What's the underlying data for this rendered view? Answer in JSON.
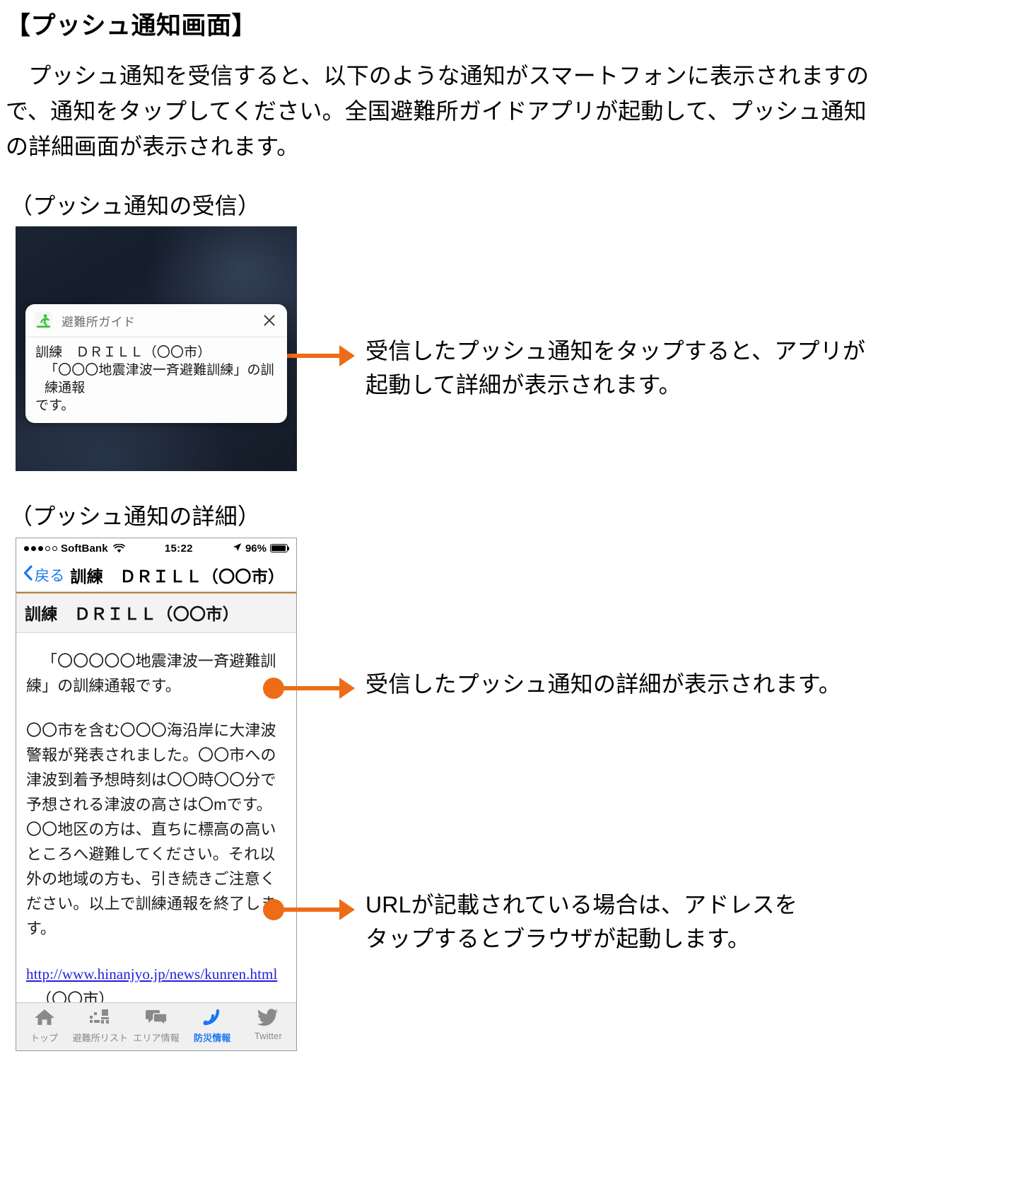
{
  "document": {
    "heading": "【プッシュ通知画面】",
    "intro_line1": "　プッシュ通知を受信すると、以下のような通知がスマートフォンに表示されますの",
    "intro_line2": "で、通知をタップしてください。全国避難所ガイドアプリが起動して、プッシュ通知",
    "intro_line3": "の詳細画面が表示されます。",
    "section_1_label": "（プッシュ通知の受信）",
    "section_2_label": "（プッシュ通知の詳細）"
  },
  "notification": {
    "app_icon_name": "running-person-icon",
    "app_name": "避難所ガイド",
    "close_icon_name": "close-icon",
    "body_line1": "訓練　ＤＲＩＬＬ（〇〇市）",
    "body_line2": "「〇〇〇地震津波一斉避難訓練」の訓練通報",
    "body_line3": "です。"
  },
  "detail_screen": {
    "status_bar": {
      "carrier": "SoftBank",
      "wifi_icon_name": "wifi-icon",
      "time": "15:22",
      "location_icon_name": "location-arrow-icon",
      "battery_percent": "96%",
      "signal_dots_filled": 3,
      "signal_dots_total": 5
    },
    "nav_bar": {
      "back_icon_name": "chevron-left-icon",
      "back_label": "戻る",
      "title": "訓練　ＤＲＩＬＬ（〇〇市）"
    },
    "title_bar": "訓練　ＤＲＩＬＬ（〇〇市）",
    "paragraph_1": "「〇〇〇〇〇地震津波一斉避難訓練」の訓練通報です。",
    "paragraph_2": "〇〇市を含む〇〇〇海沿岸に大津波警報が発表されました。〇〇市への津波到着予想時刻は〇〇時〇〇分で予想される津波の高さは〇mです。",
    "paragraph_3": "〇〇地区の方は、直ちに標高の高いところへ避難してください。それ以外の地域の方も、引き続きご注意ください。以上で訓練通報を終了します。",
    "url": "http://www.hinanjyo.jp/news/kunren.html",
    "footer_city": "（〇〇市）",
    "tabs": [
      {
        "label": "トップ",
        "icon": "home-icon",
        "active": false
      },
      {
        "label": "避難所リスト",
        "icon": "shelter-list-icon",
        "active": false
      },
      {
        "label": "エリア情報",
        "icon": "speech-bubbles-icon",
        "active": false
      },
      {
        "label": "防災情報",
        "icon": "rss-feed-icon",
        "active": true
      },
      {
        "label": "Twitter",
        "icon": "twitter-bird-icon",
        "active": false
      }
    ]
  },
  "callouts": [
    {
      "line1": "受信したプッシュ通知をタップすると、アプリが",
      "line2": "起動して詳細が表示されます。"
    },
    {
      "line1": "受信したプッシュ通知の詳細が表示されます。",
      "line2": ""
    },
    {
      "line1": "URLが記載されている場合は、アドレスを",
      "line2": "タップするとブラウザが起動します。"
    }
  ],
  "colors": {
    "accent_orange": "#ed6c16",
    "link_blue": "#1f1fe0",
    "ios_blue": "#1a76f2",
    "app_green": "#2fc32f",
    "title_rule_brown": "#b5823a"
  }
}
